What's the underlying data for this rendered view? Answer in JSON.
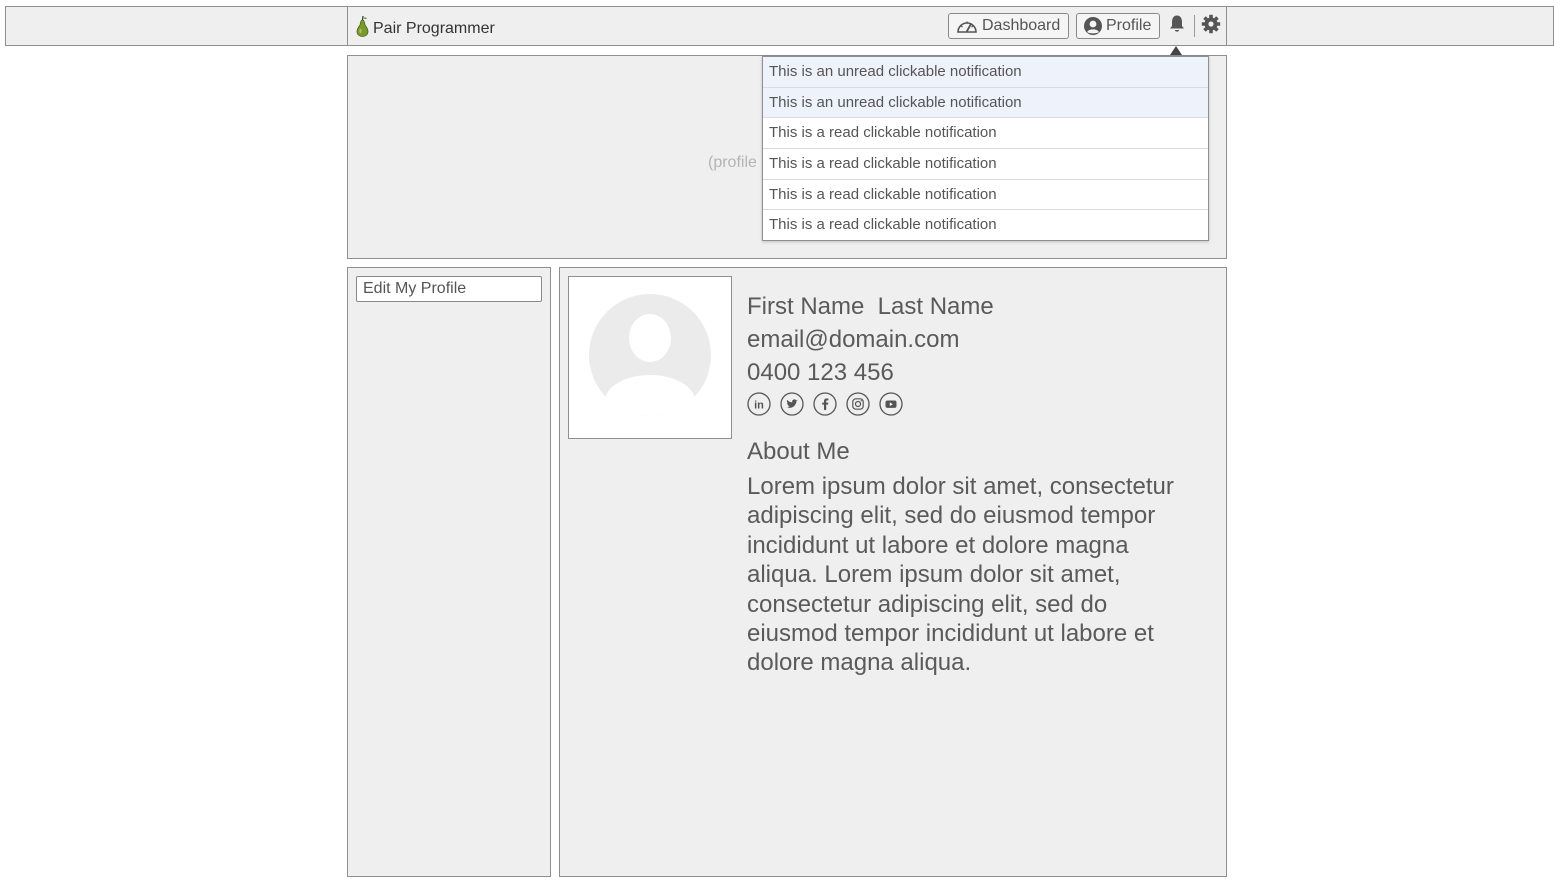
{
  "app": {
    "brand": "Pair Programmer",
    "nav": {
      "dashboard_label": "Dashboard",
      "profile_label": "Profile"
    }
  },
  "banner": {
    "placeholder": "(profile"
  },
  "sidebar": {
    "edit_profile_label": "Edit My Profile"
  },
  "profile": {
    "name": "First Name  Last Name",
    "email": "email@domain.com",
    "phone": "0400 123 456",
    "socials": [
      "linkedin-icon",
      "twitter-icon",
      "facebook-icon",
      "instagram-icon",
      "youtube-icon"
    ],
    "about_title": "About Me",
    "about_text": "Lorem ipsum dolor sit amet, consectetur adipiscing elit, sed do eiusmod tempor incididunt ut labore et dolore magna aliqua. Lorem ipsum dolor sit amet, consectetur adipiscing elit, sed do eiusmod tempor incididunt ut labore et dolore magna aliqua."
  },
  "notifications": [
    {
      "text": "This is an unread clickable notification",
      "unread": true
    },
    {
      "text": "This is an unread clickable notification",
      "unread": true
    },
    {
      "text": "This is a read clickable notification",
      "unread": false
    },
    {
      "text": "This is a read clickable notification",
      "unread": false
    },
    {
      "text": "This is a read clickable notification",
      "unread": false
    },
    {
      "text": "This is a read clickable notification",
      "unread": false
    }
  ],
  "colors": {
    "panel_bg": "#efefef",
    "border": "#8f8f8f",
    "unread_bg": "#eef2fb",
    "pear_green": "#7a9a2e"
  }
}
